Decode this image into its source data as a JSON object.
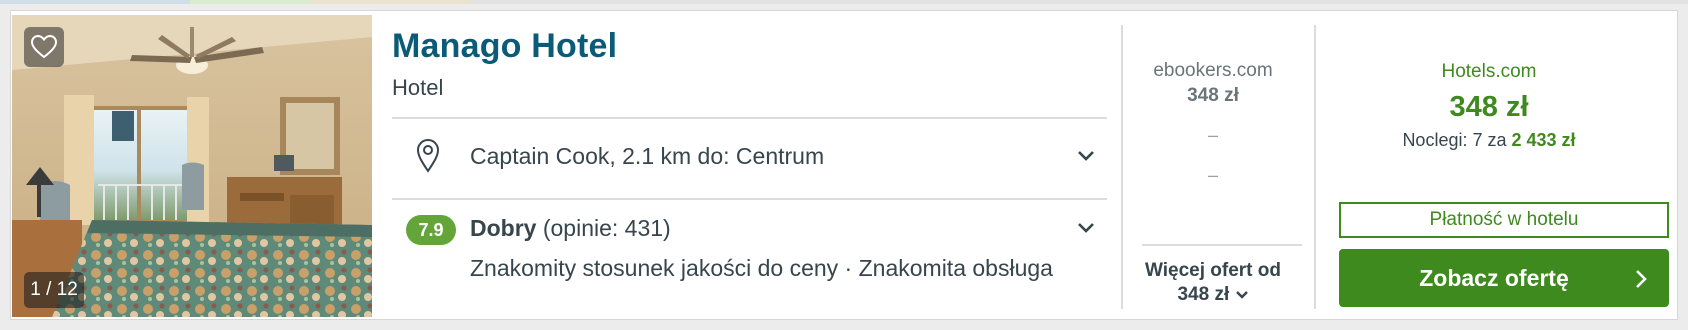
{
  "photo": {
    "counter": "1 / 12"
  },
  "hotel": {
    "name": "Manago Hotel",
    "type": "Hotel",
    "location": "Captain Cook, 2.1 km do: Centrum",
    "rating": {
      "score": "7.9",
      "label": "Dobry",
      "reviews": "(opinie: 431)",
      "highlights": "Znakomity stosunek jakości do ceny · Znakomita obsługa"
    }
  },
  "deals": {
    "provider": "ebookers.com",
    "price": "348 zł",
    "dash1": "–",
    "dash2": "–",
    "more_offers_label": "Więcej ofert od",
    "more_offers_price": "348 zł"
  },
  "best_deal": {
    "provider": "Hotels.com",
    "price": "348 zł",
    "nights_prefix": "Noclegi: 7 za",
    "nights_total": "2 433 zł",
    "pay_at_hotel": "Płatność w hotelu",
    "cta_label": "Zobacz ofertę"
  },
  "colors": {
    "title": "#0a5a78",
    "accent_green": "#3f8a1f",
    "rating_green": "#64a53a",
    "text": "#37454d"
  },
  "icons": [
    "heart-icon",
    "location-pin-icon",
    "chevron-down-icon",
    "chevron-right-icon"
  ]
}
